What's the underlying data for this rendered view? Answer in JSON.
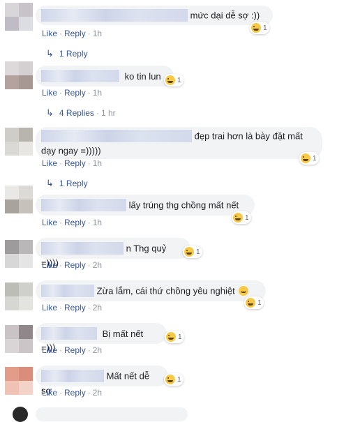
{
  "ui": {
    "like_label": "Like",
    "reply_label": "Reply",
    "separator": "·",
    "reply_arrow": "↳"
  },
  "comments": [
    {
      "text": "mức dại dễ sợ :))",
      "time": "1h",
      "reaction": {
        "icon": "haha-emoji-icon",
        "count": "1"
      }
    },
    {
      "text": "ko tin lun",
      "time": "1h",
      "reaction": {
        "icon": "haha-emoji-icon",
        "count": "1"
      }
    },
    {
      "text": "đẹp trai hơn là bày đặt mất",
      "text2": "dạy ngay =)))))",
      "time": "1h",
      "reaction": {
        "icon": "haha-emoji-icon",
        "count": "1"
      }
    },
    {
      "text": "lấy trúng thg chồng mất nết",
      "time": "1h",
      "reaction": {
        "icon": "haha-emoji-icon",
        "count": "1"
      }
    },
    {
      "text": "n Thg quỷ =))))",
      "time": "2h",
      "reaction": {
        "icon": "haha-emoji-icon",
        "count": "1"
      }
    },
    {
      "text": "Zừa lắm, cái thứ chồng yêu nghiệt",
      "time": "2h",
      "reaction": {
        "icon": "haha-emoji-icon",
        "count": "1"
      }
    },
    {
      "text": "Bị mất nết =)))",
      "time": "2h",
      "reaction": {
        "icon": "haha-emoji-icon",
        "count": "1"
      }
    },
    {
      "text": "Mất nết dễ sợ",
      "time": "2h",
      "reaction": {
        "icon": "haha-emoji-icon",
        "count": "1"
      }
    }
  ],
  "reply_links": [
    {
      "label": "1 Reply",
      "time": ""
    },
    {
      "label": "4 Replies",
      "time": "1 hr"
    },
    {
      "label": "1 Reply",
      "time": ""
    }
  ],
  "colors": {
    "link": "#385898",
    "meta": "#90949c",
    "bubble": "#f2f3f5"
  }
}
